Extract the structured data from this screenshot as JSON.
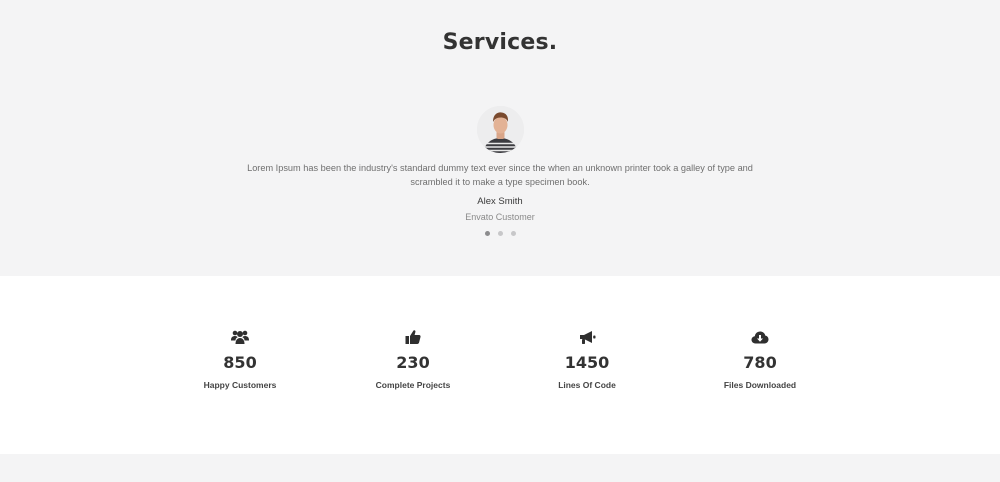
{
  "section": {
    "title": "Services."
  },
  "testimonial": {
    "quote": "Lorem Ipsum has been the industry's standard dummy text ever since the when an unknown printer took a galley of type and scrambled it to make a type specimen book.",
    "author": "Alex Smith",
    "role": "Envato Customer",
    "slides": 3,
    "active_slide": 1
  },
  "stats": [
    {
      "icon": "users-icon",
      "number": "850",
      "label": "Happy Customers"
    },
    {
      "icon": "thumbs-up-icon",
      "number": "230",
      "label": "Complete Projects"
    },
    {
      "icon": "megaphone-icon",
      "number": "1450",
      "label": "Lines Of Code"
    },
    {
      "icon": "cloud-download-icon",
      "number": "780",
      "label": "Files Downloaded"
    }
  ],
  "colors": {
    "section_bg": "#f4f4f5",
    "text_dark": "#333333",
    "muted": "#6f6f6f"
  }
}
